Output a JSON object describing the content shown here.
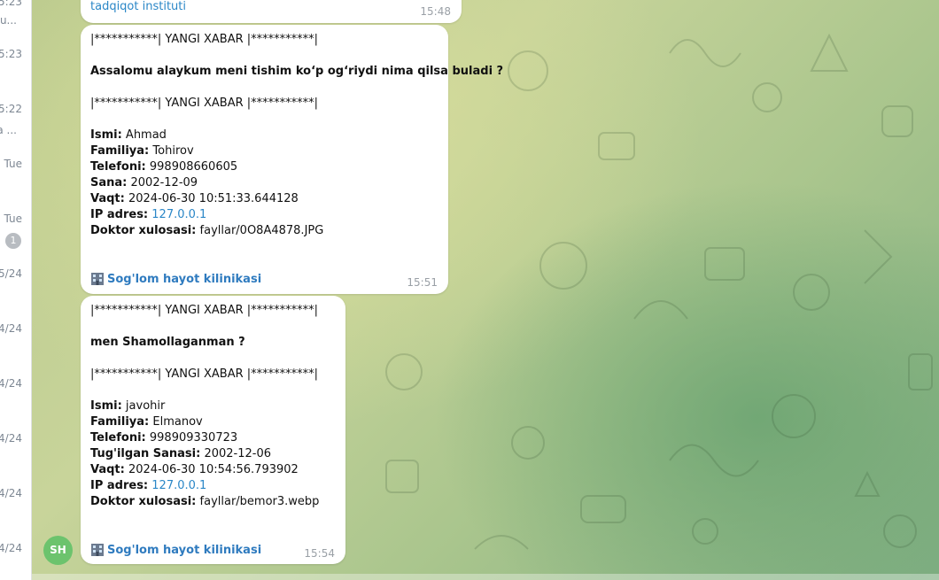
{
  "sidebar": {
    "times": [
      "5:23",
      "u...",
      "5:23",
      "5:22",
      "a ...",
      "Tue",
      "Tue",
      "5/24",
      "4/24",
      "4/24",
      "4/24",
      "4/24",
      "4/24"
    ],
    "badge": "1"
  },
  "messages": {
    "prev": {
      "text": "tadqiqot instituti",
      "time": "15:48"
    },
    "m1": {
      "header": "|***********| YANGI XABAR |***********|",
      "question": "Assalomu alaykum meni tishim ko‘p og‘riydi nima qilsa buladi ?",
      "header2": "|***********| YANGI XABAR |***********|",
      "fields": {
        "ismi_label": "Ismi:",
        "ismi": "Ahmad",
        "familiya_label": "Familiya:",
        "familiya": "Tohirov",
        "telefon_label": "Telefoni:",
        "telefon": "998908660605",
        "sana_label": "Sana:",
        "sana": "2002-12-09",
        "vaqt_label": "Vaqt:",
        "vaqt": "2024-06-30 10:51:33.644128",
        "ip_label": "IP adres:",
        "ip": "127.0.0.1",
        "doktor_label": "Doktor xulosasi:",
        "doktor": "fayllar/0O8A4878.JPG"
      },
      "clinic": "Sog'lom hayot kilinikasi",
      "time": "15:51"
    },
    "m2": {
      "header": "|***********| YANGI XABAR |***********|",
      "question": "men Shamollaganman ?",
      "header2": "|***********| YANGI XABAR |***********|",
      "fields": {
        "ismi_label": "Ismi:",
        "ismi": "javohir",
        "familiya_label": "Familiya:",
        "familiya": "Elmanov",
        "telefon_label": "Telefoni:",
        "telefon": "998909330723",
        "sana_label": "Tug'ilgan Sanasi:",
        "sana": "2002-12-06",
        "vaqt_label": "Vaqt:",
        "vaqt": "2024-06-30 10:54:56.793902",
        "ip_label": "IP adres:",
        "ip": "127.0.0.1",
        "doktor_label": "Doktor xulosasi:",
        "doktor": "fayllar/bemor3.webp"
      },
      "clinic": "Sog'lom hayot kilinikasi",
      "time": "15:54"
    }
  },
  "avatar": {
    "initials": "SH",
    "color": "#6cc36d"
  },
  "colors": {
    "link": "#2b87c7",
    "time": "#9aa0a6",
    "bubble": "#ffffff"
  },
  "icons": {
    "clinic": "office-building-icon"
  }
}
